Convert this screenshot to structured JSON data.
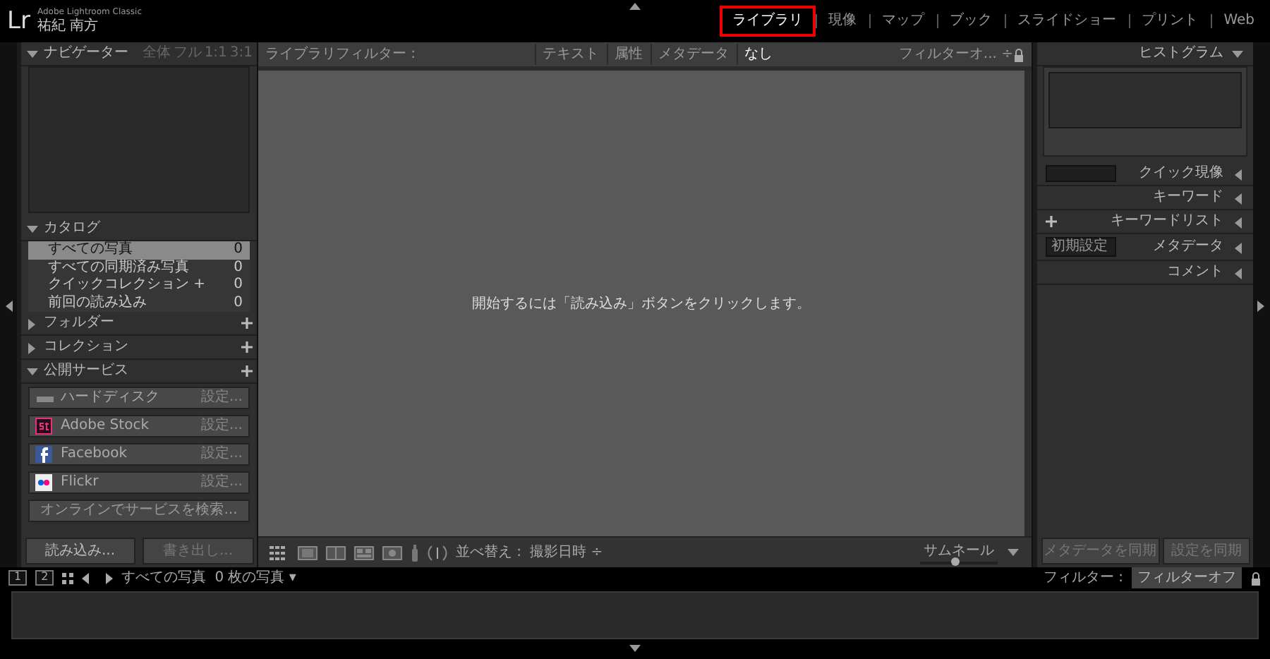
{
  "app": {
    "logo": "Lr",
    "product": "Adobe Lightroom Classic",
    "user": "祐紀 南方"
  },
  "modules": [
    {
      "label": "ライブラリ",
      "selected": true
    },
    {
      "label": "現像",
      "selected": false
    },
    {
      "label": "マップ",
      "selected": false
    },
    {
      "label": "ブック",
      "selected": false
    },
    {
      "label": "スライドショー",
      "selected": false
    },
    {
      "label": "プリント",
      "selected": false
    },
    {
      "label": "Web",
      "selected": false
    }
  ],
  "navigator": {
    "title": "ナビゲーター",
    "expanded": true,
    "zoom_options": [
      "全体",
      "フル",
      "1:1",
      "3:1"
    ]
  },
  "catalog": {
    "title": "カタログ",
    "expanded": true,
    "items": [
      {
        "label": "すべての写真",
        "count": "0",
        "selected": true
      },
      {
        "label": "すべての同期済み写真",
        "count": "0",
        "selected": false
      },
      {
        "label": "クイックコレクション +",
        "count": "0",
        "selected": false
      },
      {
        "label": "前回の読み込み",
        "count": "0",
        "selected": false
      }
    ]
  },
  "folders": {
    "title": "フォルダー",
    "expanded": false
  },
  "collections": {
    "title": "コレクション",
    "expanded": false
  },
  "publish_services": {
    "title": "公開サービス",
    "expanded": true,
    "services": [
      {
        "kind": "disk",
        "name": "ハードディスク",
        "action": "設定..."
      },
      {
        "kind": "stock",
        "name": "Adobe Stock",
        "action": "設定..."
      },
      {
        "kind": "facebook",
        "name": "Facebook",
        "action": "設定..."
      },
      {
        "kind": "flickr",
        "name": "Flickr",
        "action": "設定..."
      }
    ],
    "find_more": "オンラインでサービスを検索..."
  },
  "left_buttons": [
    {
      "label": "読み込み...",
      "disabled": false
    },
    {
      "label": "書き出し...",
      "disabled": true
    }
  ],
  "filter_bar": {
    "title": "ライブラリフィルター :",
    "tabs": [
      {
        "label": "テキスト",
        "selected": false
      },
      {
        "label": "属性",
        "selected": false
      },
      {
        "label": "メタデータ",
        "selected": false
      },
      {
        "label": "なし",
        "selected": true
      }
    ],
    "preset": "フィルターオ... ÷"
  },
  "grid_message": "開始するには「読み込み」ボタンをクリックします。",
  "toolbar": {
    "sort_label": "並べ替え :",
    "sort_value": "撮影日時 ÷",
    "thumbnail_label": "サムネール",
    "level": 0.45
  },
  "right_panels": [
    {
      "kind": "histogram",
      "title": "ヒストグラム",
      "expanded": true
    },
    {
      "kind": "select",
      "title": "クイック現像",
      "expanded": false
    },
    {
      "kind": "plain",
      "title": "キーワード",
      "expanded": false
    },
    {
      "kind": "add",
      "title": "キーワードリスト",
      "expanded": false
    },
    {
      "kind": "select",
      "title": "メタデータ",
      "expanded": false,
      "value": "初期設定"
    },
    {
      "kind": "plain",
      "title": "コメント",
      "expanded": false
    }
  ],
  "right_buttons": [
    {
      "label": "メタデータを同期",
      "disabled": true
    },
    {
      "label": "設定を同期",
      "disabled": true
    }
  ],
  "filmstrip": {
    "screens": [
      "1",
      "2"
    ],
    "source": "すべての写真",
    "count": "0 枚の写真 ▾",
    "filter_label": "フィルター :",
    "filter_value": "フィルターオフ"
  }
}
